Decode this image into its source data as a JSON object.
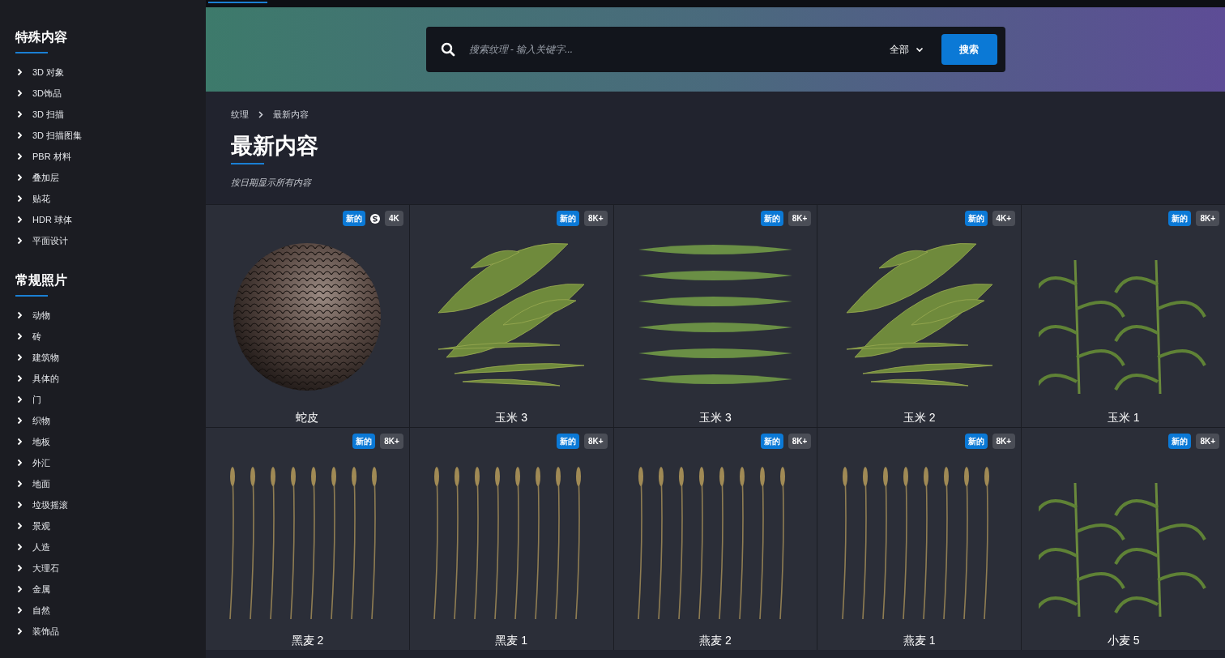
{
  "sidebar": {
    "sections": [
      {
        "heading": "特殊内容",
        "items": [
          "3D 对象",
          "3D饰品",
          "3D 扫描",
          "3D 扫描图集",
          "PBR 材料",
          "叠加层",
          "贴花",
          "HDR 球体",
          "平面设计"
        ]
      },
      {
        "heading": "常规照片",
        "items": [
          "动物",
          "砖",
          "建筑物",
          "具体的",
          "门",
          "织物",
          "地板",
          "外汇",
          "地面",
          "垃圾摇滚",
          "景观",
          "人造",
          "大理石",
          "金属",
          "自然",
          "装饰品"
        ]
      }
    ]
  },
  "search": {
    "placeholder": "搜索纹理 - 输入关键字...",
    "filter": "全部",
    "button": "搜索"
  },
  "breadcrumb": [
    "纹理",
    "最新内容"
  ],
  "page_title": "最新内容",
  "subtitle": "按日期显示所有内容",
  "tiles": [
    {
      "title": "蛇皮",
      "kind": "sphere",
      "new_badge": "新的",
      "substance": true,
      "resolution": "4K"
    },
    {
      "title": "玉米 3",
      "kind": "leaves",
      "new_badge": "新的",
      "substance": false,
      "resolution": "8K+"
    },
    {
      "title": "玉米 3",
      "kind": "leaf-stack",
      "new_badge": "新的",
      "substance": false,
      "resolution": "8K+"
    },
    {
      "title": "玉米 2",
      "kind": "leaves",
      "new_badge": "新的",
      "substance": false,
      "resolution": "4K+"
    },
    {
      "title": "玉米 1",
      "kind": "plants",
      "new_badge": "新的",
      "substance": false,
      "resolution": "8K+"
    },
    {
      "title": "黑麦 2",
      "kind": "stalks",
      "new_badge": "新的",
      "substance": false,
      "resolution": "8K+"
    },
    {
      "title": "黑麦 1",
      "kind": "stalks",
      "new_badge": "新的",
      "substance": false,
      "resolution": "8K+"
    },
    {
      "title": "燕麦 2",
      "kind": "stalks",
      "new_badge": "新的",
      "substance": false,
      "resolution": "8K+"
    },
    {
      "title": "燕麦 1",
      "kind": "stalks",
      "new_badge": "新的",
      "substance": false,
      "resolution": "8K+"
    },
    {
      "title": "小麦 5",
      "kind": "plants",
      "new_badge": "新的",
      "substance": false,
      "resolution": "8K+"
    }
  ]
}
